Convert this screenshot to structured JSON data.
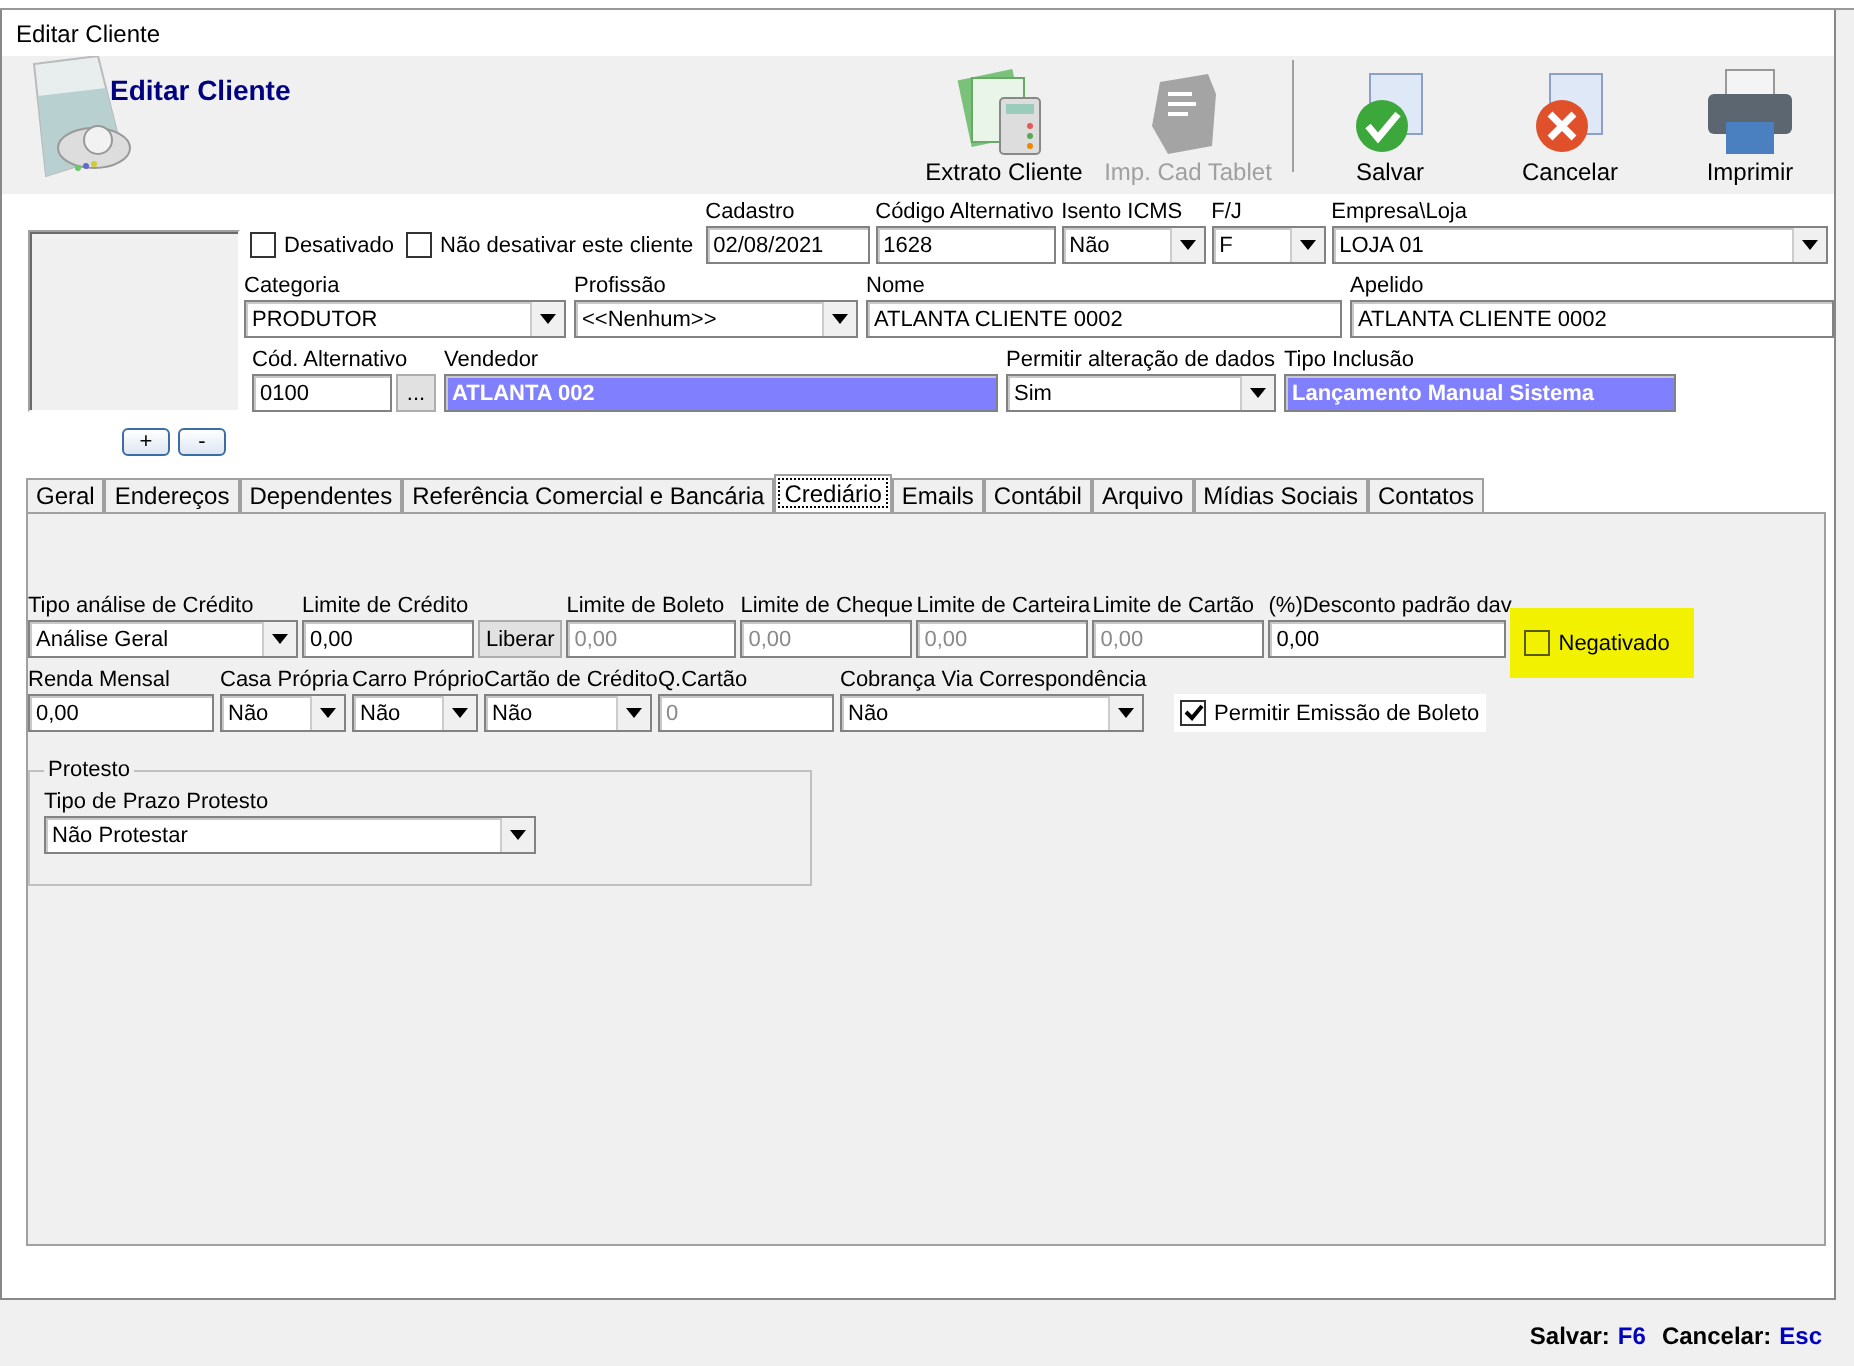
{
  "window": {
    "title": "Editar Cliente"
  },
  "header": {
    "title": "Editar Cliente"
  },
  "toolbar": [
    {
      "kind": "statement",
      "label": "Extrato Cliente",
      "disabled": false
    },
    {
      "kind": "tablet",
      "label": "Imp. Cad Tablet",
      "disabled": true
    },
    {
      "kind": "save",
      "label": "Salvar",
      "disabled": false
    },
    {
      "kind": "cancel",
      "label": "Cancelar",
      "disabled": false
    },
    {
      "kind": "print",
      "label": "Imprimir",
      "disabled": false
    }
  ],
  "photo": {
    "buttons": [
      "+",
      "-"
    ]
  },
  "flags": [
    {
      "label": "Desativado",
      "checked": false
    },
    {
      "label": "Não desativar este cliente",
      "checked": false
    }
  ],
  "row1": [
    {
      "kind": "input",
      "label": "Cadastro",
      "value": "02/08/2021"
    },
    {
      "kind": "input",
      "label": "Código Alternativo",
      "value": "1628"
    },
    {
      "kind": "select",
      "label": "Isento ICMS",
      "value": "Não"
    },
    {
      "kind": "select",
      "label": "F/J",
      "value": "F"
    },
    {
      "kind": "select",
      "label": "Empresa\\Loja",
      "value": "LOJA 01"
    }
  ],
  "row2": [
    {
      "kind": "select",
      "label": "Categoria",
      "value": "PRODUTOR"
    },
    {
      "kind": "select",
      "label": "Profissão",
      "value": "<<Nenhum>>"
    },
    {
      "kind": "input",
      "label": "Nome",
      "value": "ATLANTA CLIENTE 0002"
    },
    {
      "kind": "input",
      "label": "Apelido",
      "value": "ATLANTA CLIENTE 0002"
    }
  ],
  "row3": [
    {
      "kind": "lookup",
      "label": "Cód. Alternativo",
      "value": "0100",
      "button": "..."
    },
    {
      "kind": "highlight",
      "label": "Vendedor",
      "value": "ATLANTA 002"
    },
    {
      "kind": "select",
      "label": "Permitir alteração de dados",
      "value": "Sim"
    },
    {
      "kind": "highlight",
      "label": "Tipo Inclusão",
      "value": "Lançamento Manual Sistema"
    }
  ],
  "tabs": [
    {
      "label": "Geral",
      "selected": false
    },
    {
      "label": "Endereços",
      "selected": false
    },
    {
      "label": "Dependentes",
      "selected": false
    },
    {
      "label": "Referência Comercial  e Bancária",
      "selected": false
    },
    {
      "label": "Crediário",
      "selected": true
    },
    {
      "label": "Emails",
      "selected": false
    },
    {
      "label": "Contábil",
      "selected": false
    },
    {
      "label": "Arquivo",
      "selected": false
    },
    {
      "label": "Mídias Sociais",
      "selected": false
    },
    {
      "label": "Contatos",
      "selected": false
    }
  ],
  "credit_row1": [
    {
      "kind": "select",
      "label": "Tipo análise  de Crédito",
      "value": "Análise Geral",
      "disabled": false
    },
    {
      "kind": "input",
      "label": "Limite de Crédito",
      "value": "0,00",
      "disabled": false
    },
    {
      "kind": "button",
      "text": "Liberar"
    },
    {
      "kind": "input",
      "label": "Limite de Boleto",
      "value": "0,00",
      "disabled": true
    },
    {
      "kind": "input",
      "label": "Limite de Cheque",
      "value": "0,00",
      "disabled": true
    },
    {
      "kind": "input",
      "label": "Limite de Carteira",
      "value": "0,00",
      "disabled": true
    },
    {
      "kind": "input",
      "label": "Limite de Cartão",
      "value": "0,00",
      "disabled": true
    },
    {
      "kind": "input",
      "label": "(%)Desconto padrão dav",
      "value": "0,00",
      "disabled": false
    },
    {
      "kind": "flag",
      "label": "Negativado",
      "checked": false
    }
  ],
  "credit_row2": [
    {
      "kind": "input",
      "label": "Renda Mensal",
      "value": "0,00",
      "disabled": false
    },
    {
      "kind": "select",
      "label": "Casa Própria",
      "value": "Não",
      "disabled": false
    },
    {
      "kind": "select",
      "label": "Carro Próprio",
      "value": "Não",
      "disabled": false
    },
    {
      "kind": "select",
      "label": "Cartão de Crédito",
      "value": "Não",
      "disabled": false
    },
    {
      "kind": "input",
      "label": "Q.Cartão",
      "value": "0",
      "disabled": true
    },
    {
      "kind": "select",
      "label": "Cobrança Via Correspondência",
      "value": "Não",
      "disabled": false
    },
    {
      "kind": "flag",
      "label": "Permitir Emissão de Boleto",
      "checked": true
    }
  ],
  "protesto": {
    "title": "Protesto",
    "label": "Tipo de Prazo Protesto",
    "value": "Não Protestar"
  },
  "shortcuts": [
    {
      "label": "Salvar:",
      "key": "F6"
    },
    {
      "label": "Cancelar:",
      "key": "Esc"
    }
  ]
}
